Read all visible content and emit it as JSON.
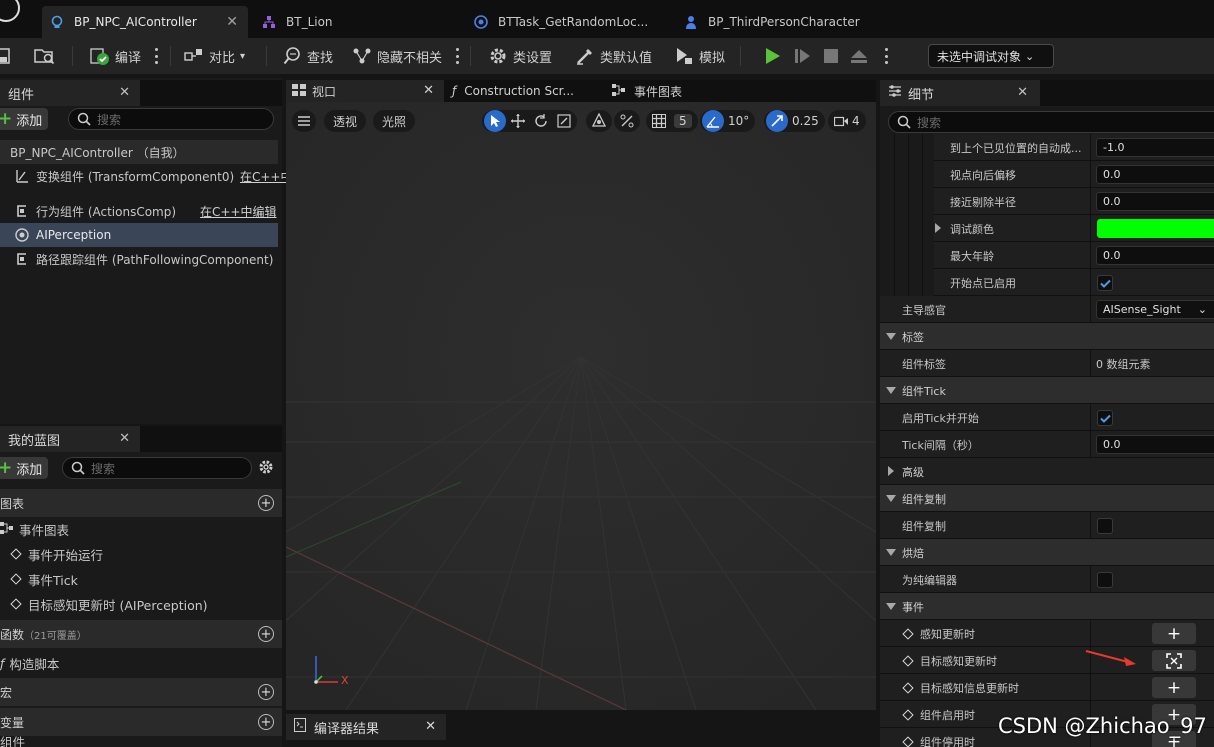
{
  "tabs": [
    {
      "label": "BP_NPC_AIController",
      "active": true
    },
    {
      "label": "BT_Lion",
      "active": false
    },
    {
      "label": "BTTask_GetRandomLoc...",
      "active": false
    },
    {
      "label": "BP_ThirdPersonCharacter",
      "active": false
    }
  ],
  "toolbar": {
    "compile": "编译",
    "diff": "对比",
    "find": "查找",
    "hide_unrelated": "隐藏不相关",
    "class_settings": "类设置",
    "class_defaults": "类默认值",
    "simulate": "模拟",
    "debug_object": "未选中调试对象"
  },
  "components_panel": {
    "tab_label": "组件",
    "add_label": "添加",
    "search_placeholder": "搜索",
    "root": "BP_NPC_AIController （自我）",
    "items": [
      {
        "label": "变换组件 (TransformComponent0)",
        "link": "在C++中",
        "icon": "transform-icon"
      },
      {
        "label": "行为组件 (ActionsComp)",
        "link": "在C++中编辑",
        "icon": "component-icon"
      },
      {
        "label": "AIPerception",
        "link": "",
        "icon": "perception-icon",
        "selected": true
      },
      {
        "label": "路径跟踪组件 (PathFollowingComponent)",
        "link": "",
        "icon": "component-icon"
      }
    ]
  },
  "my_blueprint": {
    "tab_label": "我的蓝图",
    "add_label": "添加",
    "search_placeholder": "搜索",
    "graphs_header": "图表",
    "event_graph": "事件图表",
    "events": [
      "事件开始运行",
      "事件Tick",
      "目标感知更新时 (AIPerception)"
    ],
    "functions_header": "函数",
    "functions_note": "（21可覆盖）",
    "construction_script": "构造脚本",
    "macros_header": "宏",
    "variables_header": "变量",
    "components_sub": "组件"
  },
  "viewport": {
    "tabs": [
      "视口",
      "Construction Scr...",
      "事件图表"
    ],
    "perspective": "透视",
    "lighting": "光照",
    "grid_snap": "5",
    "rotation_snap": "10°",
    "scale_snap": "0.25",
    "camera_speed": "4",
    "axis_x": "X"
  },
  "compiler_results": "编译器结果",
  "details": {
    "tab_label": "细节",
    "search_placeholder": "搜索",
    "rows": [
      {
        "label": "到上个已见位置的自动成...",
        "value": "-1.0"
      },
      {
        "label": "视点向后偏移",
        "value": "0.0"
      },
      {
        "label": "接近剔除半径",
        "value": "0.0"
      },
      {
        "label": "调试颜色",
        "color": "#00ff00"
      },
      {
        "label": "最大年龄",
        "value": "0.0"
      },
      {
        "label": "开始点已启用",
        "checked": true
      }
    ],
    "dominant_sense_label": "主导感官",
    "dominant_sense_value": "AISense_Sight",
    "tags_section": "标签",
    "component_tags_label": "组件标签",
    "component_tags_value": "0 数组元素",
    "tick_section": "组件Tick",
    "start_tick_label": "启用Tick并开始",
    "tick_interval_label": "Tick间隔（秒）",
    "tick_interval_value": "0.0",
    "advanced": "高级",
    "replication_section": "组件复制",
    "replication_label": "组件复制",
    "cooking_section": "烘焙",
    "editor_only_label": "为纯编辑器",
    "events_section": "事件",
    "events": [
      "感知更新时",
      "目标感知更新时",
      "目标感知信息更新时",
      "组件启用时",
      "组件停用时"
    ]
  },
  "watermark": "CSDN @Zhichao_97"
}
